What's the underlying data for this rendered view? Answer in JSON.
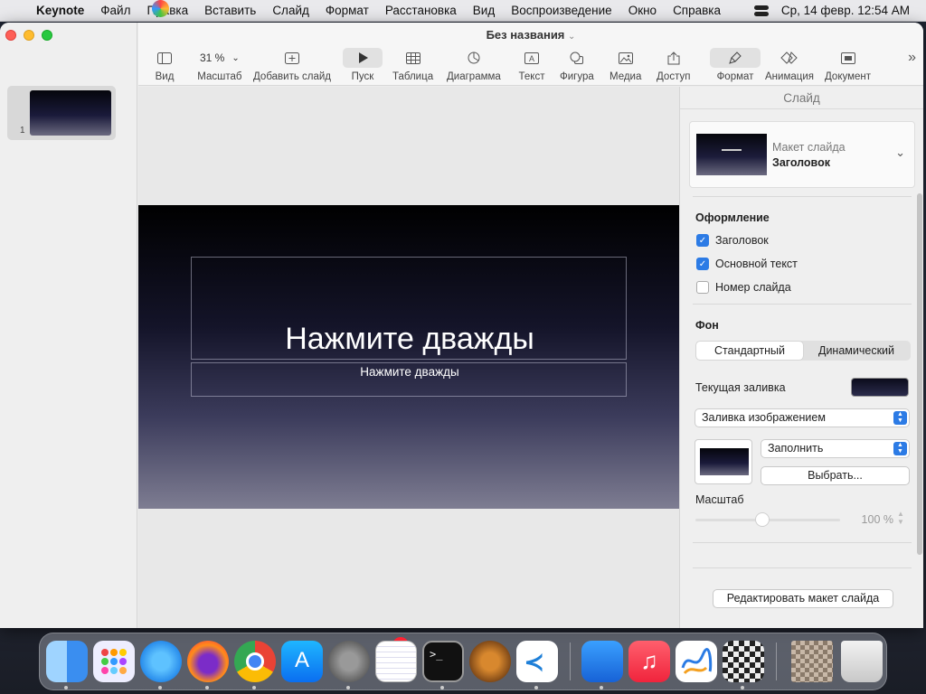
{
  "menubar": {
    "app": "Keynote",
    "items": [
      "Файл",
      "Правка",
      "Вставить",
      "Слайд",
      "Формат",
      "Расстановка",
      "Вид",
      "Воспроизведение",
      "Окно",
      "Справка"
    ],
    "datetime": "Ср, 14 февр.  12:54 AM"
  },
  "window": {
    "title": "Без названия",
    "slide_number": "1"
  },
  "toolbar": {
    "view": "Вид",
    "zoom_value": "31 %",
    "zoom": "Масштаб",
    "add_slide": "Добавить слайд",
    "play": "Пуск",
    "table": "Таблица",
    "chart": "Диаграмма",
    "text": "Текст",
    "shape": "Фигура",
    "media": "Медиа",
    "access": "Доступ",
    "format": "Формат",
    "animation": "Анимация",
    "document": "Документ"
  },
  "slide": {
    "title": "Нажмите дважды",
    "subtitle": "Нажмите дважды"
  },
  "inspector": {
    "header": "Слайд",
    "layout_caption": "Макет слайда",
    "layout_name": "Заголовок",
    "design_title": "Оформление",
    "checkboxes": [
      {
        "label": "Заголовок",
        "checked": true
      },
      {
        "label": "Основной текст",
        "checked": true
      },
      {
        "label": "Номер слайда",
        "checked": false
      }
    ],
    "background_title": "Фон",
    "segment_standard": "Стандартный",
    "segment_dynamic": "Динамический",
    "current_fill": "Текущая заливка",
    "fill_type": "Заливка изображением",
    "fill_mode": "Заполнить",
    "choose": "Выбрать...",
    "scale_label": "Масштаб",
    "scale_value": "100 %",
    "edit_layout": "Редактировать макет слайда"
  },
  "dock": {
    "badge": "2"
  }
}
